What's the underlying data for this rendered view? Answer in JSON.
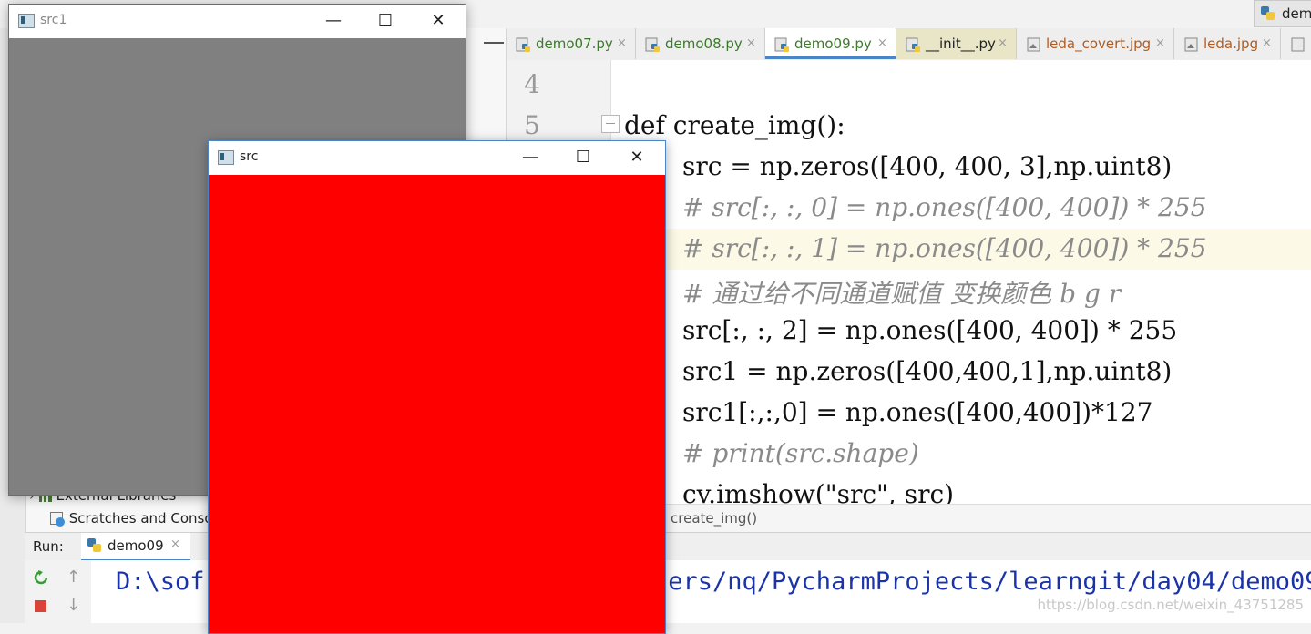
{
  "ide": {
    "run_config_label": "dem",
    "tabs": [
      {
        "label": "demo07.py",
        "kind": "py"
      },
      {
        "label": "demo08.py",
        "kind": "py"
      },
      {
        "label": "demo09.py",
        "kind": "py",
        "active": true
      },
      {
        "label": "__init__.py",
        "kind": "py"
      },
      {
        "label": "leda_covert.jpg",
        "kind": "jpg"
      },
      {
        "label": "leda.jpg",
        "kind": "jpg"
      }
    ],
    "tab_close_glyph": "×",
    "line_numbers": [
      "4",
      "5"
    ],
    "code_lines": [
      "def create_img():",
      "src = np.zeros([400, 400, 3],np.uint8)",
      "# src[:, :, 0] = np.ones([400, 400]) * 255",
      "# src[:, :, 1] = np.ones([400, 400]) * 255",
      "# 通过给不同通道赋值 变换颜色 b g r",
      "src[:, :, 2] = np.ones([400, 400]) * 255",
      "src1 = np.zeros([400,400,1],np.uint8)",
      "src1[:,:,0] = np.ones([400,400])*127",
      "# print(src.shape)",
      "cv.imshow(\"src\", src)"
    ],
    "breadcrumb": "create_img()",
    "project_tree": {
      "external_libraries": "External Libraries",
      "scratches": "Scratches and Conso"
    },
    "run_panel": {
      "label": "Run:",
      "tab_label": "demo09",
      "console_line": "D:\\software\\python\\...\\Users/nq/PycharmProjects/learngit/day04/demo09",
      "console_visible_left": "D:\\sof",
      "console_visible_right": "sers/nq/PycharmProjects/learngit/day04/demo09",
      "watermark": "https://blog.csdn.net/weixin_43751285"
    }
  },
  "windows": {
    "src1": {
      "title": "src1",
      "fill_color": "#808080"
    },
    "src": {
      "title": "src",
      "fill_color": "#ff0000"
    },
    "minimize_glyph": "—",
    "maximize_glyph": "☐",
    "close_glyph": "✕"
  },
  "colors": {
    "accent": "#4a86c7",
    "python_tab": "#3b7a2a",
    "image_tab": "#b35a1f"
  }
}
